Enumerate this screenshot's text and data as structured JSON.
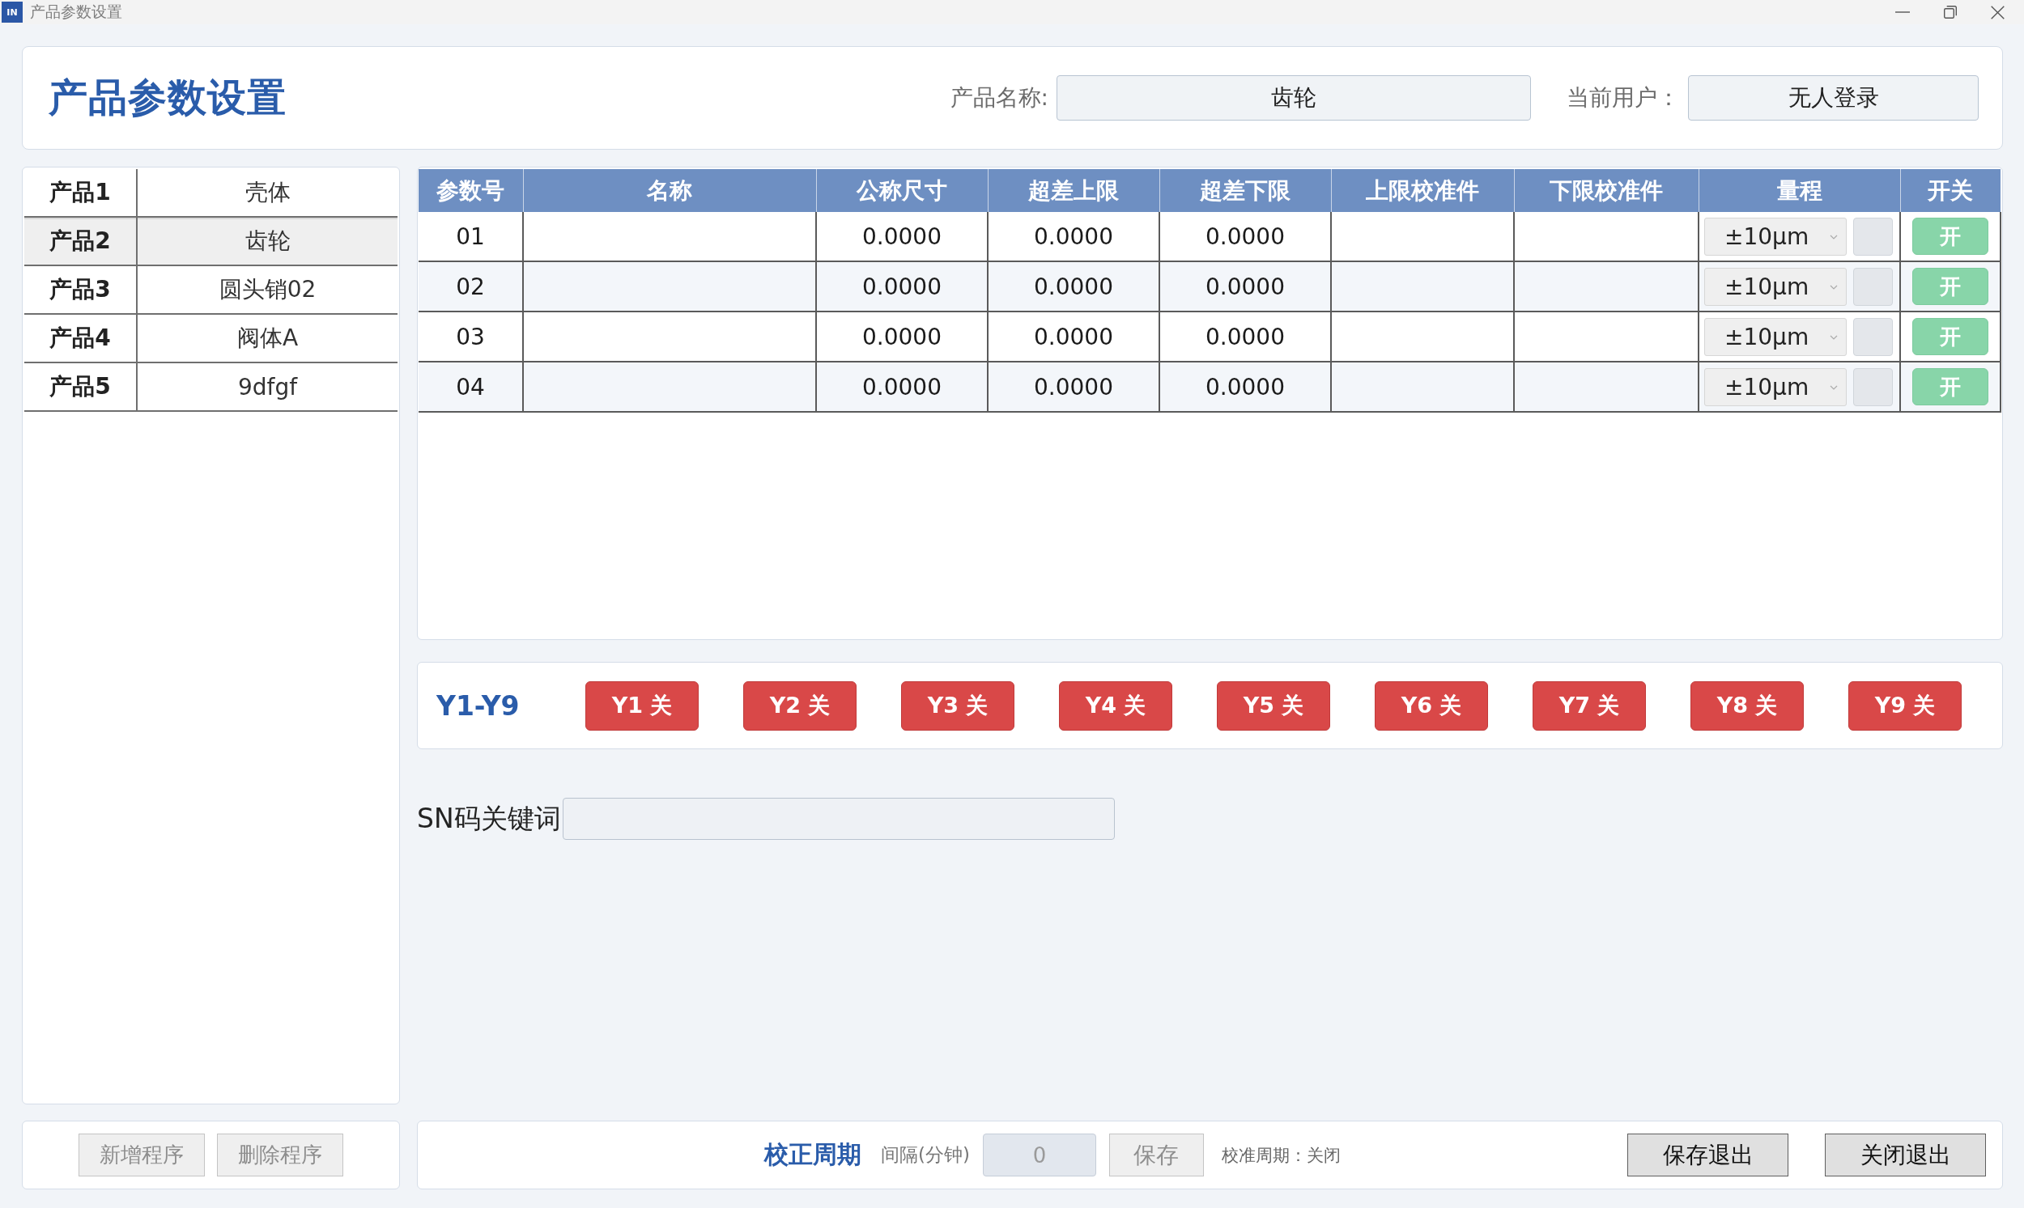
{
  "window": {
    "logo": "IN",
    "title": "产品参数设置"
  },
  "header": {
    "title": "产品参数设置",
    "product_name": {
      "label": "产品名称:",
      "value": "齿轮"
    },
    "current_user": {
      "label": "当前用户：",
      "value": "无人登录"
    }
  },
  "products": [
    {
      "label": "产品1",
      "name": "壳体",
      "selected": false
    },
    {
      "label": "产品2",
      "name": "齿轮",
      "selected": true
    },
    {
      "label": "产品3",
      "name": "圆头销02",
      "selected": false
    },
    {
      "label": "产品4",
      "name": "阀体A",
      "selected": false
    },
    {
      "label": "产品5",
      "name": "9dfgf",
      "selected": false
    }
  ],
  "params_table": {
    "columns": [
      "参数号",
      "名称",
      "公称尺寸",
      "超差上限",
      "超差下限",
      "上限校准件",
      "下限校准件",
      "量程",
      "开关"
    ],
    "rows": [
      {
        "number": "01",
        "nominal_size": "0.0000",
        "upper_limit": "0.0000",
        "lower_limit": "0.0000",
        "range": "±10μm",
        "switch": {
          "label": "开",
          "on": true
        }
      },
      {
        "number": "02",
        "nominal_size": "0.0000",
        "upper_limit": "0.0000",
        "lower_limit": "0.0000",
        "range": "±10μm",
        "switch": {
          "label": "开",
          "on": true
        }
      },
      {
        "number": "03",
        "nominal_size": "0.0000",
        "upper_limit": "0.0000",
        "lower_limit": "0.0000",
        "range": "±10μm",
        "switch": {
          "label": "开",
          "on": true
        }
      },
      {
        "number": "04",
        "nominal_size": "0.0000",
        "upper_limit": "0.0000",
        "lower_limit": "0.0000",
        "range": "±10μm",
        "switch": {
          "label": "开",
          "on": true
        }
      }
    ]
  },
  "outputs": {
    "label": "Y1-Y9",
    "buttons": [
      {
        "label": "Y1 关",
        "on": false
      },
      {
        "label": "Y2 关",
        "on": false
      },
      {
        "label": "Y3 关",
        "on": false
      },
      {
        "label": "Y4 关",
        "on": false
      },
      {
        "label": "Y5 关",
        "on": false
      },
      {
        "label": "Y6 关",
        "on": false
      },
      {
        "label": "Y7 关",
        "on": false
      },
      {
        "label": "Y8 关",
        "on": false
      },
      {
        "label": "Y9 关",
        "on": false
      }
    ]
  },
  "sn_keyword": {
    "label": "SN码关键词"
  },
  "program_buttons": [
    {
      "label": "新增程序",
      "disabled": true
    },
    {
      "label": "删除程序",
      "disabled": true
    }
  ],
  "calibration": {
    "title": "校正周期",
    "interval": {
      "label": "间隔(分钟)",
      "value": "0",
      "disabled": true
    },
    "save_button": {
      "label": "保存",
      "disabled": true
    },
    "status": "校准周期：关闭"
  },
  "exit_buttons": [
    {
      "label": "保存退出",
      "disabled": false
    },
    {
      "label": "关闭退出",
      "disabled": false
    }
  ]
}
